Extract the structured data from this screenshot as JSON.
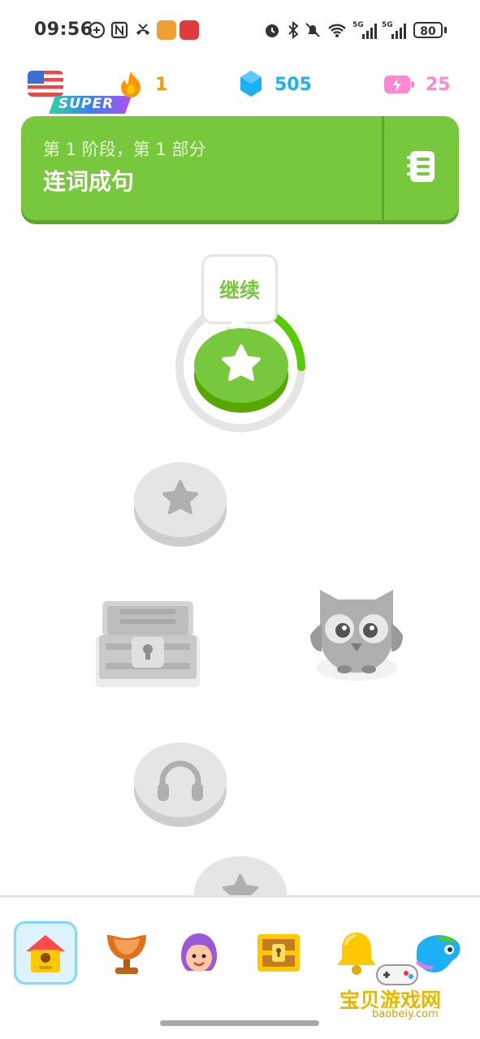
{
  "status_bar": {
    "time": "09:56",
    "battery": "80",
    "network_left": "5G",
    "network_right": "5G",
    "wifi_label": "6"
  },
  "stats": {
    "language_flag": "us-flag-icon",
    "super_label": "SUPER",
    "streak": "1",
    "gems": "505",
    "energy": "25",
    "streak_color": "#ff9600",
    "gems_color": "#1cb0f6",
    "energy_color": "#ff86d0"
  },
  "unit": {
    "subtitle": "第 1 阶段，第 1 部分",
    "title": "连词成句",
    "color": "#78c83d",
    "guidebook_icon": "guidebook-icon"
  },
  "path": {
    "tooltip_label": "继续",
    "active_progress": 0.25,
    "nodes": [
      {
        "type": "star",
        "state": "active",
        "icon": "star-icon"
      },
      {
        "type": "star",
        "state": "locked",
        "icon": "star-icon"
      },
      {
        "type": "chest",
        "state": "locked",
        "icon": "treasure-chest-icon"
      },
      {
        "type": "owl",
        "state": "locked",
        "icon": "owl-character-icon"
      },
      {
        "type": "listening",
        "state": "locked",
        "icon": "headphones-icon"
      },
      {
        "type": "star",
        "state": "locked",
        "icon": "star-icon"
      }
    ]
  },
  "nav": {
    "tabs": [
      {
        "name": "home",
        "icon": "home-icon",
        "active": true
      },
      {
        "name": "leaderboard",
        "icon": "trophy-icon",
        "active": false
      },
      {
        "name": "profile",
        "icon": "avatar-icon",
        "active": false
      },
      {
        "name": "chest",
        "icon": "treasure-chest-icon",
        "active": false
      },
      {
        "name": "notifications",
        "icon": "bell-icon",
        "active": false
      },
      {
        "name": "more",
        "icon": "duo-character-icon",
        "active": false
      }
    ]
  },
  "watermark": {
    "text": "宝贝游戏网",
    "url": "baobeiy.com"
  }
}
